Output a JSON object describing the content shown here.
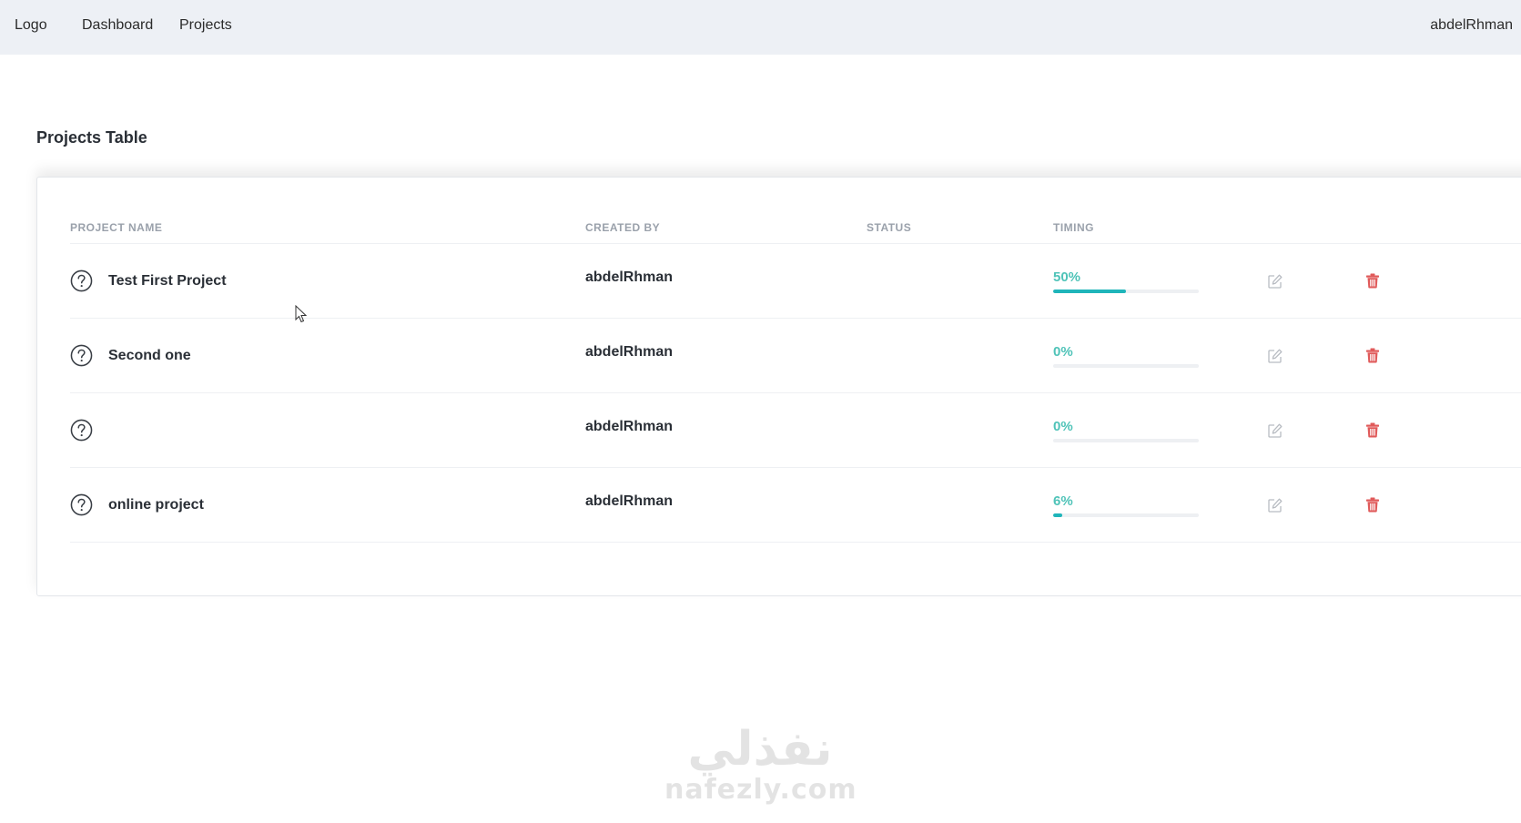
{
  "navbar": {
    "logo": "Logo",
    "links": [
      "Dashboard",
      "Projects"
    ],
    "user": "abdelRhman"
  },
  "page": {
    "title": "Projects Table"
  },
  "table": {
    "headers": {
      "project_name": "PROJECT NAME",
      "created_by": "CREATED BY",
      "status": "STATUS",
      "timing": "TIMING"
    },
    "rows": [
      {
        "name": "Test First Project",
        "created_by": "abdelRhman",
        "status": "",
        "timing_label": "50%",
        "timing_value": 50
      },
      {
        "name": "Second one",
        "created_by": "abdelRhman",
        "status": "",
        "timing_label": "0%",
        "timing_value": 0
      },
      {
        "name": "",
        "created_by": "abdelRhman",
        "status": "",
        "timing_label": "0%",
        "timing_value": 0
      },
      {
        "name": "online project",
        "created_by": "abdelRhman",
        "status": "",
        "timing_label": "6%",
        "timing_value": 6
      }
    ],
    "row_icons": {
      "status": "question-circle-icon",
      "edit": "edit-icon",
      "delete": "trash-icon"
    }
  },
  "watermark": {
    "arabic": "نفذلي",
    "latin": "nafezly.com"
  },
  "colors": {
    "navbar_bg": "#edf0f5",
    "progress_text": "#4fc3b8",
    "progress_fill": "#1fb5ba",
    "delete_red": "#e05a5a",
    "edit_gray": "#b8bcc2"
  }
}
